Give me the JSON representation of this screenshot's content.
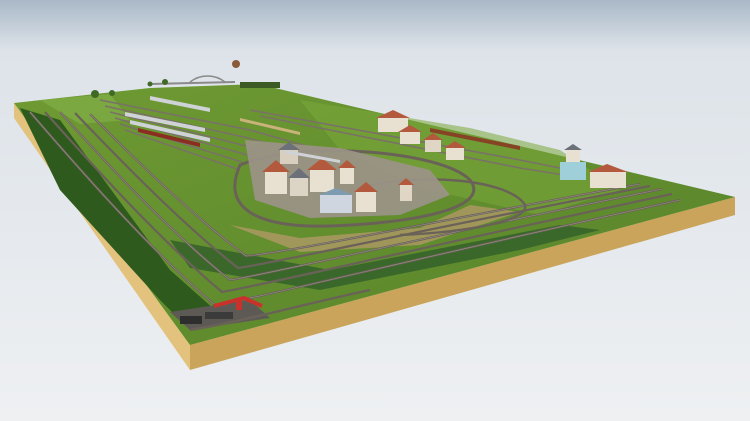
{
  "scene": {
    "subject": "model-railway-layout-3d-render",
    "colors": {
      "sky_top": "#a9b8c7",
      "sky_bottom": "#eef0f2",
      "ground_shadow": "#d6d8da",
      "grass": "#5e8a2c",
      "grass_light": "#7aa83a",
      "base_front": "#c9a45a",
      "base_side": "#e2c27c",
      "track": "#6a6258",
      "track_rail": "#9a9088",
      "ballast_town": "#9c938a",
      "roof_red": "#b35a3e",
      "roof_grey": "#6c7078",
      "wall_cream": "#e8e0d0",
      "tree": "#2f5a1e",
      "train_silver": "#cfd3d8",
      "train_red": "#8c2d22",
      "crane_red": "#c9312b"
    }
  }
}
